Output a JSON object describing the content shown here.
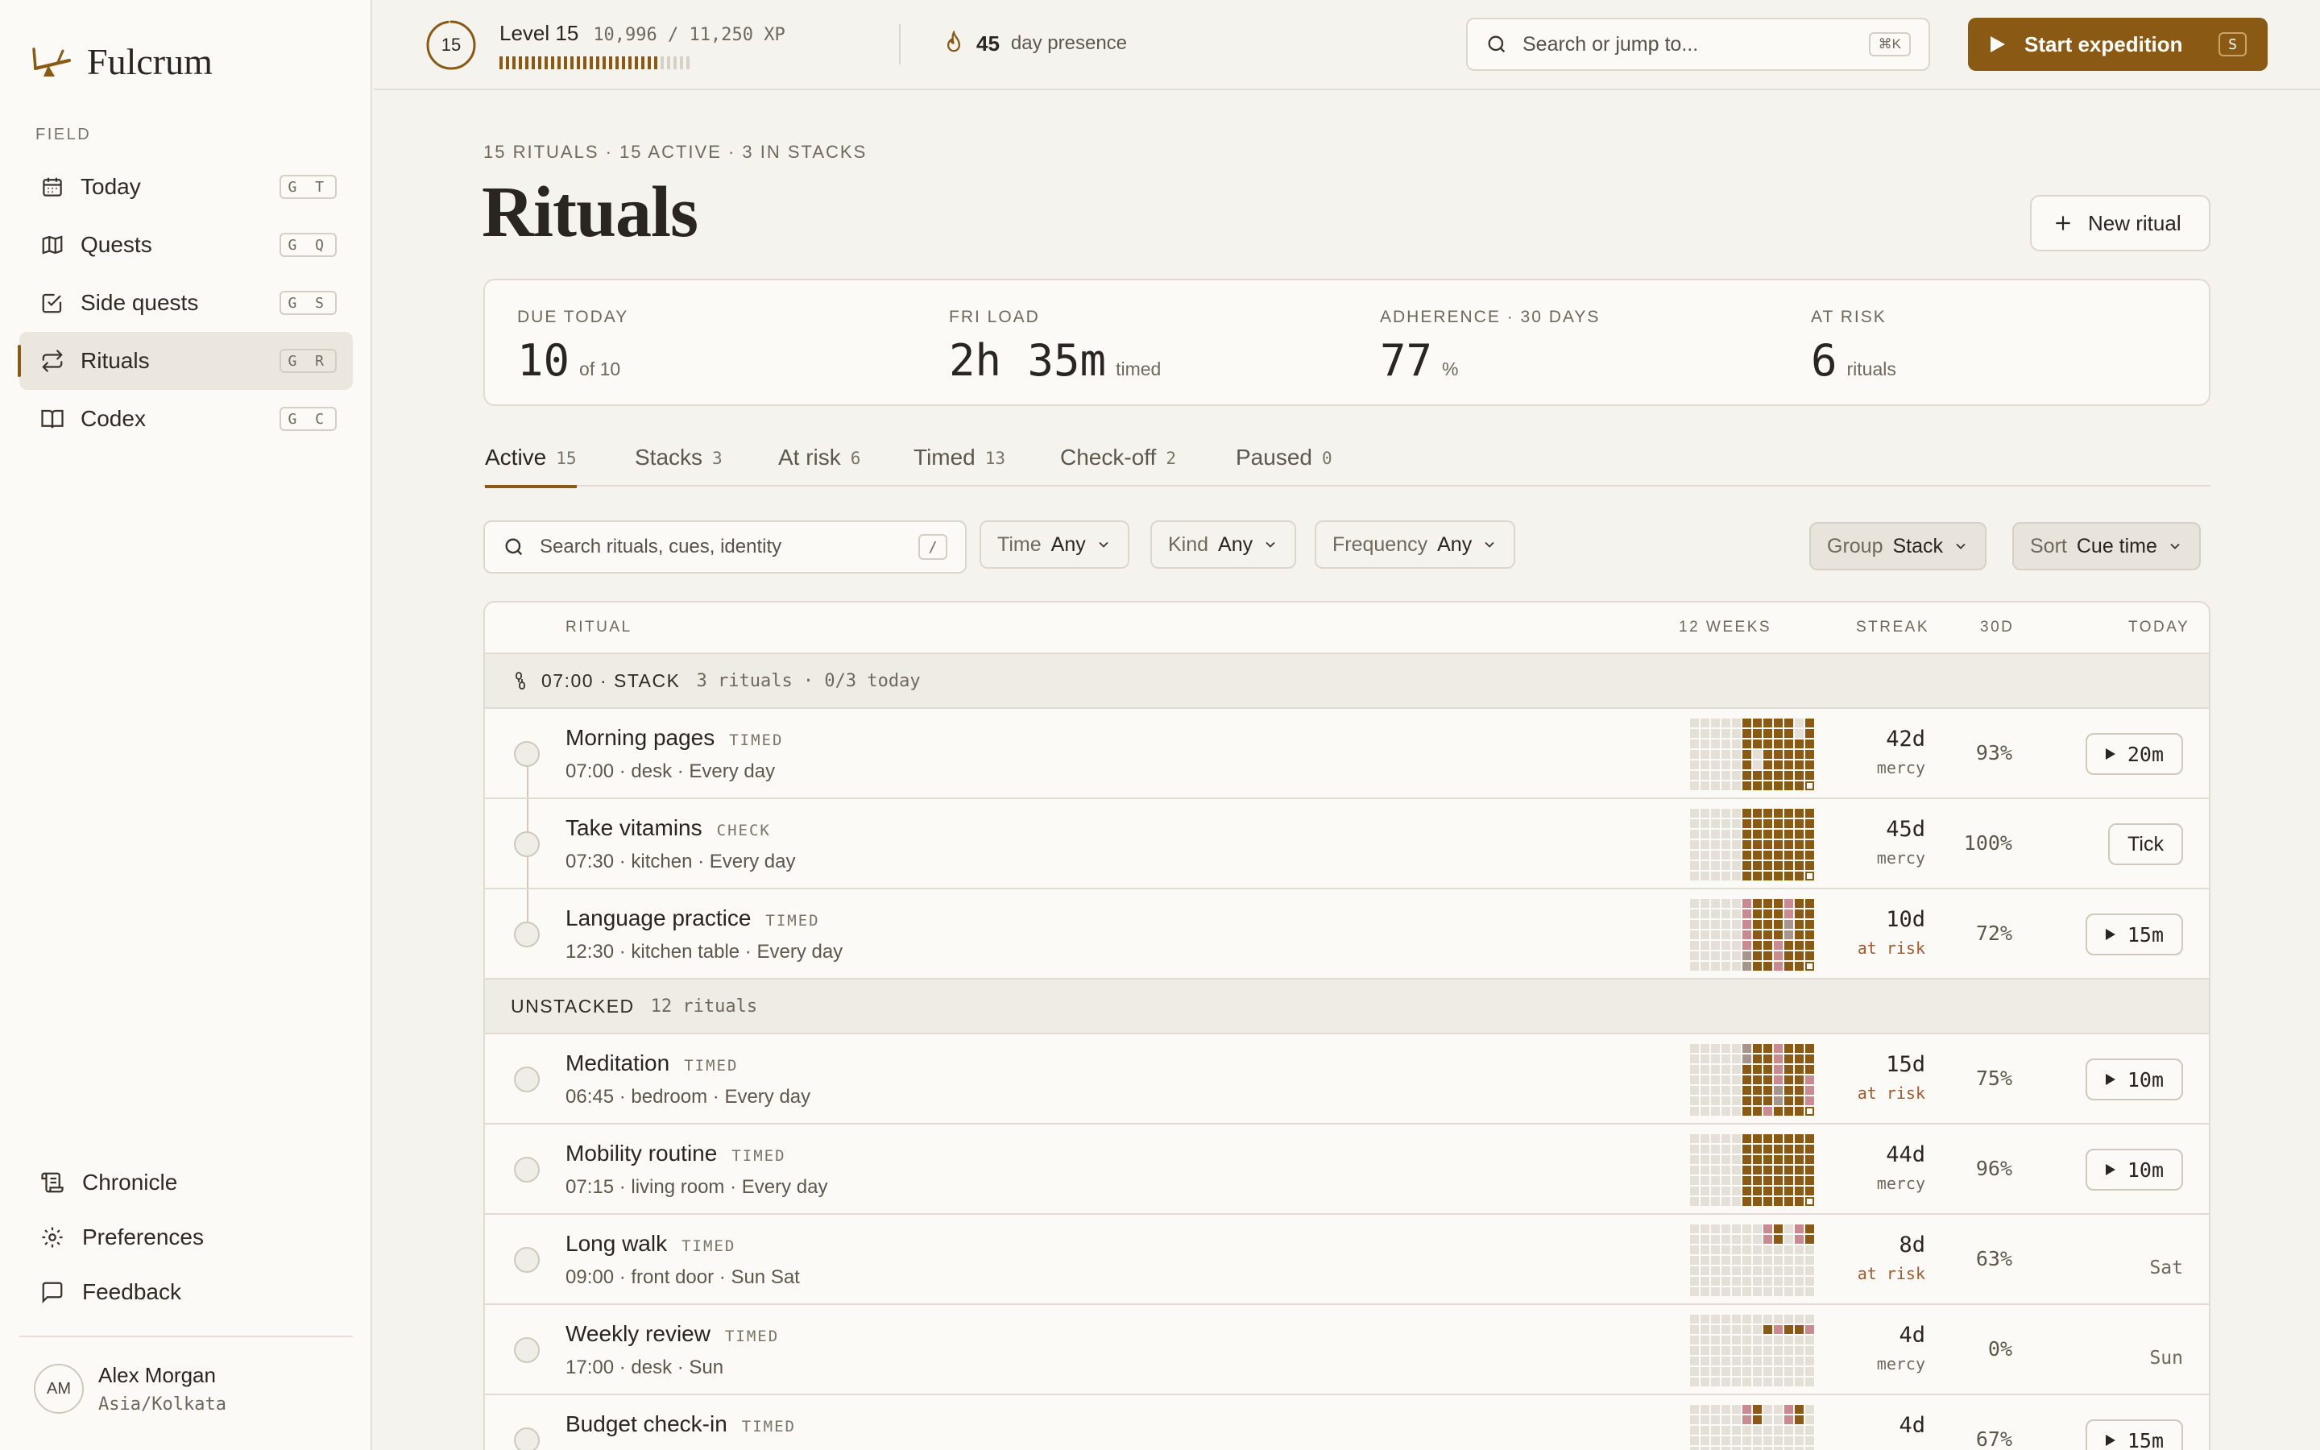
{
  "app": {
    "name": "Fulcrum"
  },
  "sidebar": {
    "section_label": "FIELD",
    "items": [
      {
        "label": "Today",
        "shortcut": "G T",
        "icon": "calendar-icon"
      },
      {
        "label": "Quests",
        "shortcut": "G Q",
        "icon": "map-icon"
      },
      {
        "label": "Side quests",
        "shortcut": "G S",
        "icon": "checkbox-icon"
      },
      {
        "label": "Rituals",
        "shortcut": "G R",
        "icon": "repeat-icon",
        "active": true
      },
      {
        "label": "Codex",
        "shortcut": "G C",
        "icon": "book-icon"
      }
    ],
    "bottom": [
      {
        "label": "Chronicle",
        "icon": "scroll-icon"
      },
      {
        "label": "Preferences",
        "icon": "gear-icon"
      },
      {
        "label": "Feedback",
        "icon": "message-icon"
      }
    ],
    "user": {
      "initials": "AM",
      "name": "Alex Morgan",
      "timezone": "Asia/Kolkata"
    }
  },
  "topbar": {
    "level_number": "15",
    "level_label": "Level 15",
    "xp_text": "10,996 / 11,250 XP",
    "xp_progress": 0.977,
    "presence_count": "45",
    "presence_label": "day presence",
    "search_placeholder": "Search or jump to...",
    "search_shortcut": "⌘K",
    "start_label": "Start expedition",
    "start_shortcut": "S"
  },
  "page": {
    "eyebrow": "15 RITUALS · 15 ACTIVE · 3 IN STACKS",
    "title": "Rituals",
    "new_button": "New ritual"
  },
  "stats": [
    {
      "label": "DUE TODAY",
      "value": "10",
      "unit": "of 10"
    },
    {
      "label": "FRI LOAD",
      "value": "2h 35m",
      "unit": "timed"
    },
    {
      "label": "ADHERENCE · 30 DAYS",
      "value": "77",
      "unit": "%"
    },
    {
      "label": "AT RISK",
      "value": "6",
      "unit": "rituals"
    }
  ],
  "tabs": [
    {
      "label": "Active",
      "count": "15",
      "active": true
    },
    {
      "label": "Stacks",
      "count": "3"
    },
    {
      "label": "At risk",
      "count": "6"
    },
    {
      "label": "Timed",
      "count": "13"
    },
    {
      "label": "Check-off",
      "count": "2"
    },
    {
      "label": "Paused",
      "count": "0"
    }
  ],
  "filters": {
    "search_placeholder": "Search rituals, cues, identity",
    "search_shortcut": "/",
    "time": {
      "key": "Time",
      "value": "Any"
    },
    "kind": {
      "key": "Kind",
      "value": "Any"
    },
    "frequency": {
      "key": "Frequency",
      "value": "Any"
    },
    "group": {
      "key": "Group",
      "value": "Stack"
    },
    "sort": {
      "key": "Sort",
      "value": "Cue time"
    }
  },
  "table": {
    "columns": {
      "ritual": "RITUAL",
      "weeks": "12 WEEKS",
      "streak": "STREAK",
      "thirty": "30D",
      "today": "TODAY"
    },
    "groups": [
      {
        "label": "07:00 · STACK",
        "count": "3 rituals · 0/3 today"
      },
      {
        "label": "UNSTACKED",
        "count": "12 rituals"
      }
    ],
    "rows": [
      {
        "name": "Morning pages",
        "kind": "TIMED",
        "meta": "07:00 · desk · Every day",
        "streak": "42d",
        "status": "mercy",
        "pct": "93%",
        "today": "20m",
        "today_type": "play",
        "heat": "strong"
      },
      {
        "name": "Take vitamins",
        "kind": "CHECK",
        "meta": "07:30 · kitchen · Every day",
        "streak": "45d",
        "status": "mercy",
        "pct": "100%",
        "today": "Tick",
        "today_type": "button",
        "heat": "full"
      },
      {
        "name": "Language practice",
        "kind": "TIMED",
        "meta": "12:30 · kitchen table · Every day",
        "streak": "10d",
        "status": "at risk",
        "pct": "72%",
        "today": "15m",
        "today_type": "play",
        "heat": "mixed"
      },
      {
        "name": "Meditation",
        "kind": "TIMED",
        "meta": "06:45 · bedroom · Every day",
        "streak": "15d",
        "status": "at risk",
        "pct": "75%",
        "today": "10m",
        "today_type": "play",
        "heat": "mixed"
      },
      {
        "name": "Mobility routine",
        "kind": "TIMED",
        "meta": "07:15 · living room · Every day",
        "streak": "44d",
        "status": "mercy",
        "pct": "96%",
        "today": "10m",
        "today_type": "play",
        "heat": "full"
      },
      {
        "name": "Long walk",
        "kind": "TIMED",
        "meta": "09:00 · front door · Sun Sat",
        "streak": "8d",
        "status": "at risk",
        "pct": "63%",
        "today": "Sat",
        "today_type": "text",
        "heat": "sparse"
      },
      {
        "name": "Weekly review",
        "kind": "TIMED",
        "meta": "17:00 · desk · Sun",
        "streak": "4d",
        "status": "mercy",
        "pct": "0%",
        "today": "Sun",
        "today_type": "text",
        "heat": "weekly"
      },
      {
        "name": "Budget check-in",
        "kind": "TIMED",
        "meta": "",
        "streak": "4d",
        "status": "",
        "pct": "67%",
        "today": "15m",
        "today_type": "play",
        "heat": "sparse"
      }
    ]
  },
  "colors": {
    "accent": "#8a5a14",
    "risk": "#a65a2a",
    "heat_pink": "#c98a92",
    "heat_empty": "#e4e0d7"
  }
}
